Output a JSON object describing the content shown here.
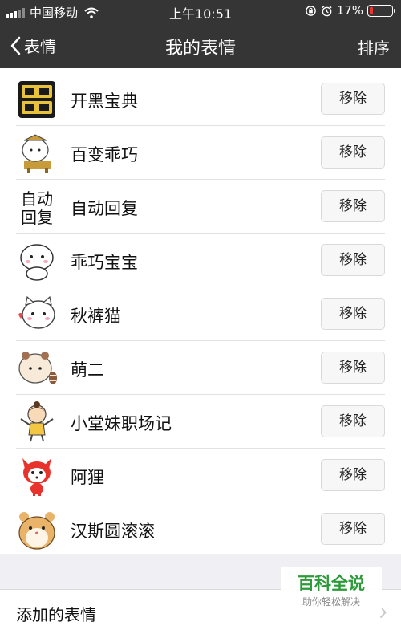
{
  "status_bar": {
    "carrier": "中国移动",
    "time": "上午10:51",
    "battery": "17%",
    "battery_level": 0.17
  },
  "nav": {
    "back_label": "表情",
    "title": "我的表情",
    "right_label": "排序"
  },
  "stickers": [
    {
      "name": "开黑宝典",
      "remove_label": "移除",
      "icon": "kaihei-baodian-icon"
    },
    {
      "name": "百变乖巧",
      "remove_label": "移除",
      "icon": "baibian-guaiqiao-icon"
    },
    {
      "name": "自动回复",
      "remove_label": "移除",
      "icon": "zidong-huifu-icon",
      "icon_text": "自动回复"
    },
    {
      "name": "乖巧宝宝",
      "remove_label": "移除",
      "icon": "guaiqiao-baobao-icon"
    },
    {
      "name": "秋裤猫",
      "remove_label": "移除",
      "icon": "qiuku-mao-icon"
    },
    {
      "name": "萌二",
      "remove_label": "移除",
      "icon": "meng-er-icon"
    },
    {
      "name": "小堂妹职场记",
      "remove_label": "移除",
      "icon": "xiaotangmei-icon"
    },
    {
      "name": "阿狸",
      "remove_label": "移除",
      "icon": "ali-fox-icon"
    },
    {
      "name": "汉斯圆滚滚",
      "remove_label": "移除",
      "icon": "hansi-hamster-icon"
    }
  ],
  "added_section": {
    "label": "添加的表情"
  },
  "watermark": {
    "title": "百科全说",
    "subtitle": "助你轻松解决"
  },
  "colors": {
    "nav_bg": "#353535",
    "page_bg": "#efeff4",
    "watermark_green": "#2b9a38"
  }
}
